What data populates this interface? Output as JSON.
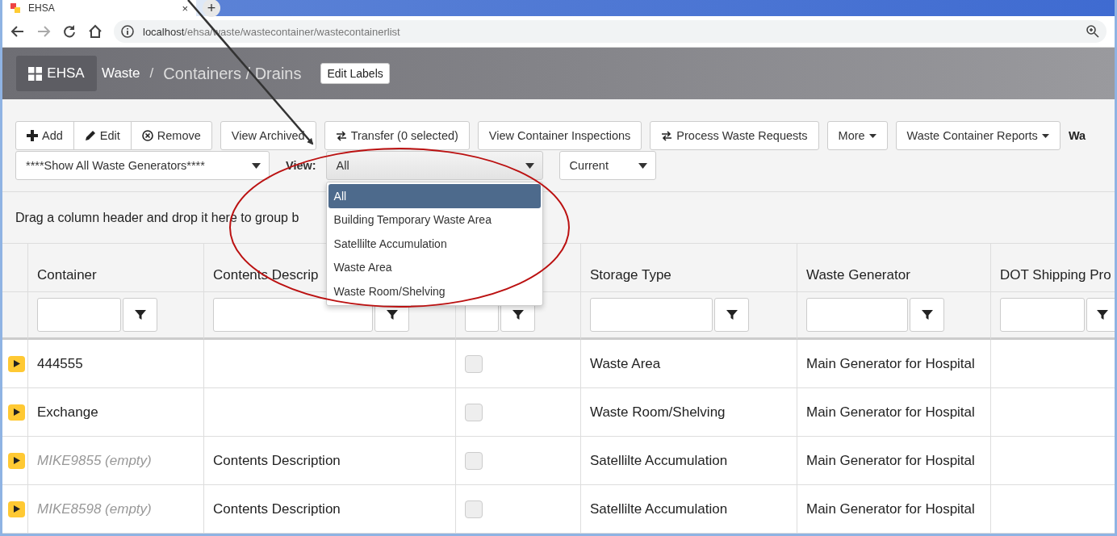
{
  "browser": {
    "tab_title": "EHSA",
    "tab_close": "×",
    "new_tab": "+",
    "url_host": "localhost",
    "url_path": "/ehsa/waste/wastecontainer/wastecontainerlist"
  },
  "header": {
    "brand": "EHSA",
    "breadcrumb": "Waste",
    "separator": "/",
    "title": "Containers / Drains",
    "edit_labels": "Edit Labels"
  },
  "toolbar": {
    "group": [
      {
        "label": "Add",
        "kind": "plus"
      },
      {
        "label": "Edit",
        "kind": "pencil"
      },
      {
        "label": "Remove",
        "kind": "remove"
      }
    ],
    "buttons": [
      {
        "label": "View Archived",
        "kind": "plain",
        "caret": false
      },
      {
        "label": "Transfer (0 selected)",
        "kind": "transfer",
        "caret": false
      },
      {
        "label": "View Container Inspections",
        "kind": "plain",
        "caret": false
      },
      {
        "label": "Process Waste Requests",
        "kind": "transfer",
        "caret": false
      },
      {
        "label": "More",
        "kind": "plain",
        "caret": true
      },
      {
        "label": "Waste Container Reports",
        "kind": "plain",
        "caret": true
      }
    ],
    "cut_label": "Wa",
    "generator_select": "****Show All Waste Generators****",
    "view_label": "View:",
    "view_select": "All",
    "period_select": "Current",
    "view_options": [
      {
        "label": "All",
        "selected": true
      },
      {
        "label": "Building Temporary Waste Area",
        "selected": false
      },
      {
        "label": "Satellilte Accumulation",
        "selected": false
      },
      {
        "label": "Waste Area",
        "selected": false
      },
      {
        "label": "Waste Room/Shelving",
        "selected": false
      }
    ]
  },
  "group_hint": "Drag a column header and drop it here to group b",
  "table": {
    "columns": [
      "Container",
      "Contents Descrip",
      "",
      "Storage Type",
      "Waste Generator",
      "DOT Shipping Pro"
    ],
    "rows": [
      {
        "container": "444555",
        "empty": false,
        "contents": "",
        "checked": false,
        "storage_type": "Waste Area",
        "generator": "Main Generator for Hospital"
      },
      {
        "container": "Exchange",
        "empty": false,
        "contents": "",
        "checked": false,
        "storage_type": "Waste Room/Shelving",
        "generator": "Main Generator for Hospital"
      },
      {
        "container": "MIKE9855 (empty)",
        "empty": true,
        "contents": "Contents Description",
        "checked": false,
        "storage_type": "Satellilte Accumulation",
        "generator": "Main Generator for Hospital"
      },
      {
        "container": "MIKE8598 (empty)",
        "empty": true,
        "contents": "Contents Description",
        "checked": false,
        "storage_type": "Satellilte Accumulation",
        "generator": "Main Generator for Hospital"
      }
    ]
  }
}
